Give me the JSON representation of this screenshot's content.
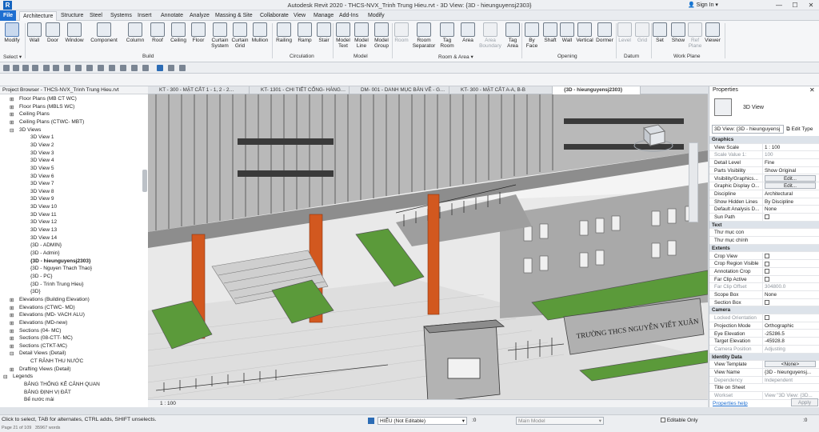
{
  "app": {
    "title": "Autodesk Revit 2020 - THCS-NVX_Trinh Trung Hieu.rvt - 3D View: {3D - hieunguyensj2303}",
    "logo_letter": "R",
    "sign_in": "Sign In"
  },
  "ribbon_tabs": [
    "File",
    "Architecture",
    "Structure",
    "Steel",
    "Systems",
    "Insert",
    "Annotate",
    "Analyze",
    "Massing & Site",
    "Collaborate",
    "View",
    "Manage",
    "Add-Ins",
    "Modify"
  ],
  "ribbon": {
    "modify": "Modify",
    "select": "Select ▾",
    "build_buttons": [
      "Wall",
      "Door",
      "Window",
      "Component",
      "Column",
      "Roof",
      "Ceiling",
      "Floor",
      "Curtain System",
      "Curtain Grid",
      "Mullion"
    ],
    "circulation_buttons": [
      "Railing",
      "Ramp",
      "Stair"
    ],
    "model_buttons": [
      "Model Text",
      "Model Line",
      "Model Group"
    ],
    "room_buttons": [
      "Room",
      "Room Separator",
      "Tag Room",
      "Area",
      "Area Boundary",
      "Tag Area"
    ],
    "opening_buttons": [
      "By Face",
      "Shaft",
      "Wall",
      "Vertical",
      "Dormer"
    ],
    "datum_buttons": [
      "Level",
      "Grid"
    ],
    "workplane_buttons": [
      "Set",
      "Show",
      "Ref Plane",
      "Viewer"
    ],
    "groups": {
      "build": "Build",
      "circulation": "Circulation",
      "model": "Model",
      "room_area": "Room & Area ▾",
      "opening": "Opening",
      "datum": "Datum",
      "work_plane": "Work Plane"
    }
  },
  "project_browser": {
    "header": "Project Browser - THCS-NVX_Trinh Trung Hieu.rvt",
    "items": [
      {
        "label": "Floor Plans (MB CT WC)",
        "level": 1,
        "toggle": "+"
      },
      {
        "label": "Floor Plans (MBLS WC)",
        "level": 1,
        "toggle": "+"
      },
      {
        "label": "Ceiling Plans",
        "level": 1,
        "toggle": "+"
      },
      {
        "label": "Ceiling Plans (CTWC- MBT)",
        "level": 1,
        "toggle": "+"
      },
      {
        "label": "3D Views",
        "level": 1,
        "toggle": "−"
      },
      {
        "label": "3D View 1",
        "level": 2
      },
      {
        "label": "3D View 2",
        "level": 2
      },
      {
        "label": "3D View 3",
        "level": 2
      },
      {
        "label": "3D View 4",
        "level": 2
      },
      {
        "label": "3D View 5",
        "level": 2
      },
      {
        "label": "3D View 6",
        "level": 2
      },
      {
        "label": "3D View 7",
        "level": 2
      },
      {
        "label": "3D View 8",
        "level": 2
      },
      {
        "label": "3D View 9",
        "level": 2
      },
      {
        "label": "3D View 10",
        "level": 2
      },
      {
        "label": "3D View 11",
        "level": 2
      },
      {
        "label": "3D View 12",
        "level": 2
      },
      {
        "label": "3D View 13",
        "level": 2
      },
      {
        "label": "3D View 14",
        "level": 2
      },
      {
        "label": "{3D - ADMIN}",
        "level": 2
      },
      {
        "label": "{3D - Admin}",
        "level": 2
      },
      {
        "label": "{3D - hieunguyensj2303}",
        "level": 2,
        "selected": true
      },
      {
        "label": "{3D - Nguyen Thach Thao}",
        "level": 2
      },
      {
        "label": "{3D - PC}",
        "level": 2
      },
      {
        "label": "{3D - Trinh Trung Hieu}",
        "level": 2
      },
      {
        "label": "{3D}",
        "level": 2
      },
      {
        "label": "Elevations (Building Elevation)",
        "level": 1,
        "toggle": "+"
      },
      {
        "label": "Elevations (CTWC- MD)",
        "level": 1,
        "toggle": "+"
      },
      {
        "label": "Elevations (MD- VACH ALU)",
        "level": 1,
        "toggle": "+"
      },
      {
        "label": "Elevations (MD-new)",
        "level": 1,
        "toggle": "+"
      },
      {
        "label": "Sections (04- MC)",
        "level": 1,
        "toggle": "+"
      },
      {
        "label": "Sections (08-CTT- MC)",
        "level": 1,
        "toggle": "+"
      },
      {
        "label": "Sections (CTKT-MC)",
        "level": 1,
        "toggle": "+"
      },
      {
        "label": "Detail Views (Detail)",
        "level": 1,
        "toggle": "−"
      },
      {
        "label": "CT RÃNH THU NƯỚC",
        "level": 2
      },
      {
        "label": "Drafting Views (Detail)",
        "level": 1,
        "toggle": "+"
      },
      {
        "label": "Legends",
        "level": 0,
        "toggle": "−"
      },
      {
        "label": "BẢNG THỐNG KÊ CẢNH QUAN",
        "level": 1
      },
      {
        "label": "BẢNG ĐỊNH VỊ ĐẤT",
        "level": 1
      },
      {
        "label": "Bể nước mái",
        "level": 1
      }
    ]
  },
  "view_tabs": [
    "KT - 300 - MẶT CẮT 1 - 1, 2 - 2…",
    "KT- 1301 - CHI TIẾT CỔNG- HÀNG…",
    "DM- 001 - DANH MỤC BẢN VẼ - G…",
    "KT- 300 - MẶT CẮT A-A, B-B",
    "{3D - hieunguyensj2303}"
  ],
  "viewport": {
    "sign_text": "TRƯỜNG THCS NGUYỄN VIẾT XUÂN",
    "scale": "1 : 100"
  },
  "properties": {
    "header": "Properties",
    "type_name": "3D View",
    "selector": "3D View: {3D - hieunguyensj",
    "edit_type": "Edit Type",
    "rows": [
      {
        "section": "Graphics"
      },
      {
        "k": "View Scale",
        "v": "1 : 100"
      },
      {
        "k": "Scale Value    1:",
        "v": "100",
        "dim": true
      },
      {
        "k": "Detail Level",
        "v": "Fine"
      },
      {
        "k": "Parts Visibility",
        "v": "Show Original"
      },
      {
        "k": "Visibility/Graphics...",
        "v": "Edit...",
        "btn": true
      },
      {
        "k": "Graphic Display O...",
        "v": "Edit...",
        "btn": true
      },
      {
        "k": "Discipline",
        "v": "Architectural"
      },
      {
        "k": "Show Hidden Lines",
        "v": "By Discipline"
      },
      {
        "k": "Default Analysis D...",
        "v": "None"
      },
      {
        "k": "Sun Path",
        "v": "",
        "cb": true
      },
      {
        "section": "Text"
      },
      {
        "k": "Thư mục con",
        "v": ""
      },
      {
        "k": "Thư mục chính",
        "v": ""
      },
      {
        "section": "Extents"
      },
      {
        "k": "Crop View",
        "v": "",
        "cb": true
      },
      {
        "k": "Crop Region Visible",
        "v": "",
        "cb": true
      },
      {
        "k": "Annotation Crop",
        "v": "",
        "cb": true
      },
      {
        "k": "Far Clip Active",
        "v": "",
        "cb": true
      },
      {
        "k": "Far Clip Offset",
        "v": "304800.0",
        "dim": true
      },
      {
        "k": "Scope Box",
        "v": "None"
      },
      {
        "k": "Section Box",
        "v": "",
        "cb": true
      },
      {
        "section": "Camera"
      },
      {
        "k": "Locked Orientation",
        "v": "",
        "cb": true,
        "dim": true
      },
      {
        "k": "Projection Mode",
        "v": "Orthographic"
      },
      {
        "k": "Eye Elevation",
        "v": "-25286.5"
      },
      {
        "k": "Target Elevation",
        "v": "-45928.8"
      },
      {
        "k": "Camera Position",
        "v": "Adjusting",
        "dim": true
      },
      {
        "section": "Identity Data"
      },
      {
        "k": "View Template",
        "v": "<None>",
        "btn": true
      },
      {
        "k": "View Name",
        "v": "{3D - hieunguyensj..."
      },
      {
        "k": "Dependency",
        "v": "Independent",
        "dim": true
      },
      {
        "k": "Title on Sheet",
        "v": ""
      },
      {
        "k": "Workset",
        "v": "View \"3D View: {3D...",
        "dim": true
      }
    ],
    "help": "Properties help",
    "apply": "Apply"
  },
  "statusbar": {
    "hint": "Click to select, TAB for alternates, CTRL adds, SHIFT unselects.",
    "page": "Page 21 of 109",
    "words": "35967 words",
    "workset": "HIỂU (Not Editable)",
    "zero": ":0",
    "main_model": "Main Model",
    "editable_only": "Editable Only",
    "filter": ":0"
  },
  "colors": {
    "accent": "#1f6fd1",
    "column": "#d2581f",
    "grass": "#5b9a3a",
    "concrete": "#c9c9c9"
  }
}
